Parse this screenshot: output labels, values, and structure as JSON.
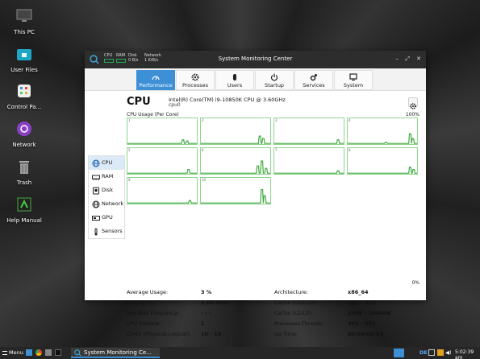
{
  "desktop": {
    "icons": [
      {
        "label": "This PC",
        "icon": "monitor-icon"
      },
      {
        "label": "User Files",
        "icon": "folder-icon"
      },
      {
        "label": "Control Pa...",
        "icon": "control-panel-icon"
      },
      {
        "label": "Network",
        "icon": "network-icon"
      },
      {
        "label": "Trash",
        "icon": "trash-icon"
      },
      {
        "label": "Help Manual",
        "icon": "help-manual-icon"
      }
    ]
  },
  "window": {
    "title": "System Monitoring Center",
    "mini": {
      "cpu": "CPU",
      "ram": "RAM",
      "disk": "Disk",
      "disk_val": "0 B/s",
      "network": "Network",
      "network_val": "1 KiB/s"
    },
    "controls": {
      "minimize": "–",
      "restore": "⤢",
      "close": "✕"
    },
    "tabs": [
      {
        "label": "Performance",
        "icon": "performance-icon",
        "active": true
      },
      {
        "label": "Processes",
        "icon": "gear-icon",
        "active": false
      },
      {
        "label": "Users",
        "icon": "user-icon",
        "active": false
      },
      {
        "label": "Startup",
        "icon": "power-icon",
        "active": false
      },
      {
        "label": "Services",
        "icon": "services-icon",
        "active": false
      },
      {
        "label": "System",
        "icon": "computer-icon",
        "active": false
      }
    ],
    "sidebar": [
      {
        "label": "CPU",
        "icon": "globe-icon",
        "active": true
      },
      {
        "label": "RAM",
        "icon": "ram-icon",
        "active": false
      },
      {
        "label": "Disk",
        "icon": "disk-icon",
        "active": false
      },
      {
        "label": "Network",
        "icon": "network-icon",
        "active": false
      },
      {
        "label": "GPU",
        "icon": "gpu-icon",
        "active": false
      },
      {
        "label": "Sensors",
        "icon": "sensors-icon",
        "active": false
      }
    ]
  },
  "cpu": {
    "heading": "CPU",
    "model": "Intel(R) Core(TM) i9-10850K CPU @ 3.60GHz",
    "id": "cpu0",
    "usage_label": "CPU Usage (Per Core)",
    "max_label": "100%",
    "min_label": "0%",
    "graph_color": "#44aa44",
    "cores": [
      {
        "n": "1",
        "usage": [
          0,
          0,
          0,
          0,
          0,
          0,
          0,
          0,
          0,
          0,
          0,
          0,
          0,
          0,
          0,
          0,
          0,
          0,
          0,
          0,
          0,
          0,
          0,
          0,
          0,
          0,
          0,
          0,
          0,
          0,
          0,
          0,
          0,
          0,
          0,
          0,
          0,
          0,
          0,
          0,
          0,
          0,
          0,
          0,
          0,
          0,
          0,
          0,
          0,
          0,
          0,
          0,
          0,
          0,
          0,
          0,
          0,
          0,
          0,
          0,
          0,
          0,
          0,
          0,
          0,
          0,
          0,
          0,
          0,
          0,
          0,
          0,
          0,
          0,
          0,
          0,
          0,
          0,
          0,
          0,
          0,
          0,
          0,
          0,
          0,
          0,
          0,
          0,
          0,
          0,
          0,
          0,
          0,
          0,
          0,
          0,
          0,
          0,
          0,
          0,
          0,
          0,
          0,
          0,
          0,
          0,
          0,
          0,
          0,
          0,
          0,
          0,
          0,
          0,
          0,
          0,
          0,
          0,
          0,
          0,
          0,
          0,
          0,
          0,
          0,
          0,
          0,
          0,
          0,
          0,
          0,
          0,
          0,
          0,
          0,
          0,
          0,
          0,
          0,
          0,
          0,
          0,
          0,
          0,
          0,
          0,
          0,
          0,
          0,
          0,
          0,
          0,
          0,
          0,
          0,
          0,
          0,
          0,
          0,
          0,
          0,
          0,
          0,
          0,
          0,
          0,
          0,
          0,
          0,
          0,
          0,
          0,
          0,
          0,
          0,
          0,
          0,
          0,
          0,
          0,
          0,
          0,
          0,
          0,
          0,
          0,
          0,
          0,
          0,
          0,
          0,
          0,
          0,
          0,
          0,
          0,
          0,
          0,
          0,
          0
        ]
      }
    ],
    "stats_left": [
      {
        "label": "Average Usage:",
        "value": "3 %"
      },
      {
        "label": "Frequency:",
        "value": "3.60 GHz"
      },
      {
        "label": "Min-Max Frequency:",
        "value": "- - -"
      },
      {
        "label": "CPU Sockets:",
        "value": "1"
      },
      {
        "label": "Cores (Physical-Logical):",
        "value": "10 - 10"
      }
    ],
    "stats_right": [
      {
        "label": "Architecture:",
        "value": "x86_64"
      },
      {
        "label": "Cache (L1d-L1i):",
        "value": "32K - 32K"
      },
      {
        "label": "Cache (L2-L3):",
        "value": "256K - 20480K"
      },
      {
        "label": "Processes-Threads:",
        "value": "305 - 559"
      },
      {
        "label": "Up Time:",
        "value": "00:00:09:52"
      }
    ]
  },
  "taskbar": {
    "menu": "Menu",
    "task": "System Monitoring Ce...",
    "keyboard": "DE",
    "clock": "5:02:39 am"
  }
}
